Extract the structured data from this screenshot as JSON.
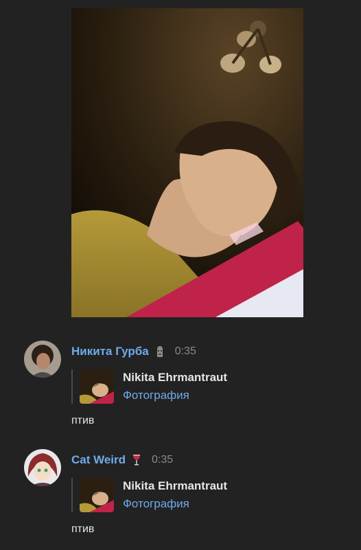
{
  "photo": {
    "alt": ""
  },
  "messages": [
    {
      "author": "Никита Гурба",
      "status_icon": "moai-icon",
      "time": "0:35",
      "reply": {
        "author": "Nikita Ehrmantraut",
        "type": "Фотография"
      },
      "text": "птив"
    },
    {
      "author": "Cat Weird",
      "status_icon": "wine-glass-icon",
      "time": "0:35",
      "reply": {
        "author": "Nikita Ehrmantraut",
        "type": "Фотография"
      },
      "text": "птив"
    }
  ],
  "colors": {
    "background": "#222222",
    "accent": "#71aaeb",
    "muted": "#8a8a8a"
  }
}
